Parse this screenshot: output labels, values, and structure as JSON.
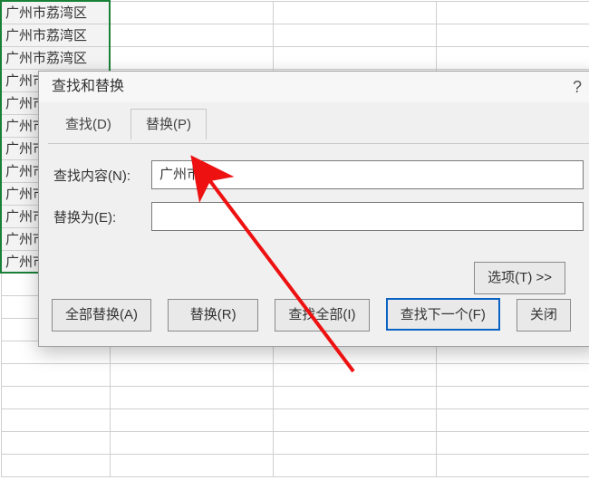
{
  "sheet": {
    "cell_text": "广州市荔湾区",
    "partial_cell_text": "广州市荔",
    "truncated_cell_text": "广州市"
  },
  "dialog": {
    "title": "查找和替换",
    "help": "?",
    "tabs": {
      "find": "查找(D)",
      "replace": "替换(P)"
    },
    "fields": {
      "find_label": "查找内容(N):",
      "find_value": "广州市",
      "replace_label": "替换为(E):",
      "replace_value": ""
    },
    "options_btn": "选项(T) >>",
    "buttons": {
      "replace_all": "全部替换(A)",
      "replace": "替换(R)",
      "find_all": "查找全部(I)",
      "find_next": "查找下一个(F)",
      "close": "关闭"
    }
  }
}
